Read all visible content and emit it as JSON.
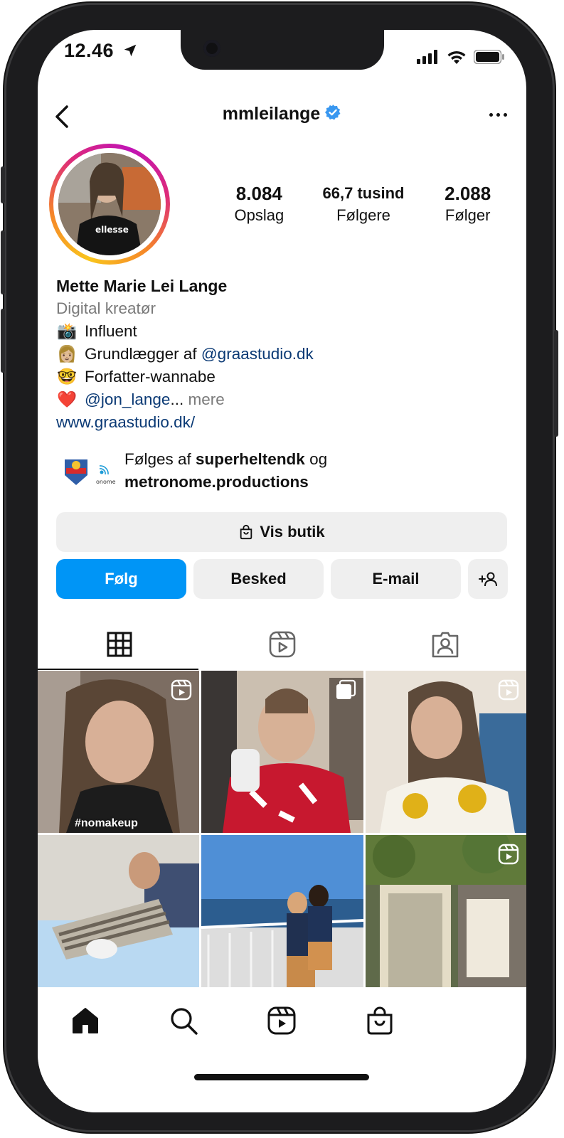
{
  "status": {
    "time": "12.46"
  },
  "header": {
    "username": "mmleilange"
  },
  "stats": [
    {
      "value": "8.084",
      "label": "Opslag"
    },
    {
      "value": "66,7 tusind",
      "label": "Følgere"
    },
    {
      "value": "2.088",
      "label": "Følger"
    }
  ],
  "bio": {
    "name": "Mette Marie Lei Lange",
    "category": "Digital kreatør",
    "lines": [
      {
        "emoji": "📸",
        "text": "Influent"
      },
      {
        "emoji": "👩🏼",
        "text": "Grundlægger af ",
        "link": "@graastudio.dk"
      },
      {
        "emoji": "🤓",
        "text": "Forfatter-wannabe"
      },
      {
        "emoji": "❤️",
        "link": "@jon_lange",
        "suffix": "...",
        "more": " mere"
      }
    ],
    "website": "www.graastudio.dk/"
  },
  "followed_by": {
    "prefix": "Følges af ",
    "user1": "superheltendk",
    "joiner": " og",
    "user2": "metronome.productions"
  },
  "buttons": {
    "shop": "Vis butik",
    "follow": "Følg",
    "message": "Besked",
    "email": "E-mail"
  },
  "grid": {
    "tag_text": "#nomakeup"
  },
  "colors": {
    "accent": "#0095f6",
    "link": "#0b3a75",
    "verified": "#3897f0",
    "button_bg": "#efefef"
  },
  "icons": {
    "back": "chevron-left-icon",
    "more": "more-horizontal-icon",
    "shop": "shopping-bag-icon",
    "add_person": "add-person-icon",
    "grid_tab": "grid-icon",
    "reels_tab": "reels-icon",
    "tagged_tab": "tagged-person-icon",
    "nav": [
      "home-icon",
      "search-icon",
      "reels-icon",
      "shop-bag-icon"
    ]
  }
}
